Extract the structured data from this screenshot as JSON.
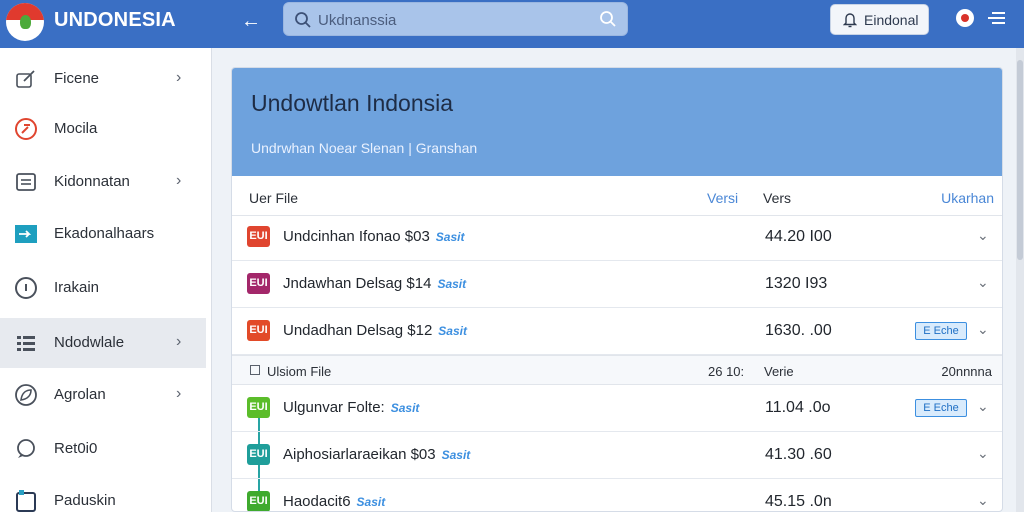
{
  "header": {
    "brand": "UNDONESIA",
    "search_placeholder": "Ukdnanssia",
    "notification_label": "Eindonal"
  },
  "sidebar": {
    "items": [
      {
        "label": "Ficene",
        "icon": "edit-icon",
        "chevron": true
      },
      {
        "label": "Mocila",
        "icon": "compass-icon",
        "chevron": false
      },
      {
        "label": "Kidonnatan",
        "icon": "document-icon",
        "chevron": true
      },
      {
        "label": "Ekadonalhaars",
        "icon": "card-icon",
        "chevron": false
      },
      {
        "label": "Irakain",
        "icon": "circle-icon",
        "chevron": false
      },
      {
        "label": "Ndodwlale",
        "icon": "list-icon",
        "chevron": true,
        "active": true
      },
      {
        "label": "Agrolan",
        "icon": "leaf-icon",
        "chevron": true
      },
      {
        "label": "Ret0i0",
        "icon": "bubble-icon",
        "chevron": false
      },
      {
        "label": "Paduskin",
        "icon": "file-icon",
        "chevron": false
      }
    ]
  },
  "main": {
    "title": "Undowtlan Indonsia",
    "subtitle": "Undrwhan  Noear  Slenan  |  Granshan",
    "columns": {
      "file": "Uer File",
      "versi": "Versi",
      "vers": "Vers",
      "ukaran": "Ukarhan"
    },
    "section2": {
      "file": "Ulsiom File",
      "date": "26 10:",
      "vers": "Verie",
      "size": "20nnnna"
    },
    "rows": [
      {
        "badge": "EUI",
        "badge_color": "#e0452f",
        "name": "Undcinhan Ifonao $03",
        "tag": "Sasit",
        "value": "44.20 I00",
        "pill": ""
      },
      {
        "badge": "EUI",
        "badge_color": "#a3276a",
        "name": "Jndawhan  Delsag $14",
        "tag": "Sasit",
        "value": "1320 I93",
        "pill": ""
      },
      {
        "badge": "EUI",
        "badge_color": "#e24a28",
        "name": "Undadhan  Delsag $12",
        "tag": "Sasit",
        "value": "1630. .00",
        "pill": "E Eche"
      }
    ],
    "rows2": [
      {
        "badge": "EUI",
        "badge_color": "#5bbd2a",
        "name": "Ulgunvar Folte:",
        "tag": "Sasit",
        "value": "11.04 .0o",
        "pill": "E Eche"
      },
      {
        "badge": "EUI",
        "badge_color": "#1f9e9a",
        "name": "Aiphosiarlaraeikan $03",
        "tag": "Sasit",
        "value": "41.30 .60",
        "pill": ""
      },
      {
        "badge": "EUI",
        "badge_color": "#3faa2e",
        "name": "Haodacit6",
        "tag": "Sasit",
        "value": "45.15 .0n",
        "pill": ""
      }
    ]
  }
}
